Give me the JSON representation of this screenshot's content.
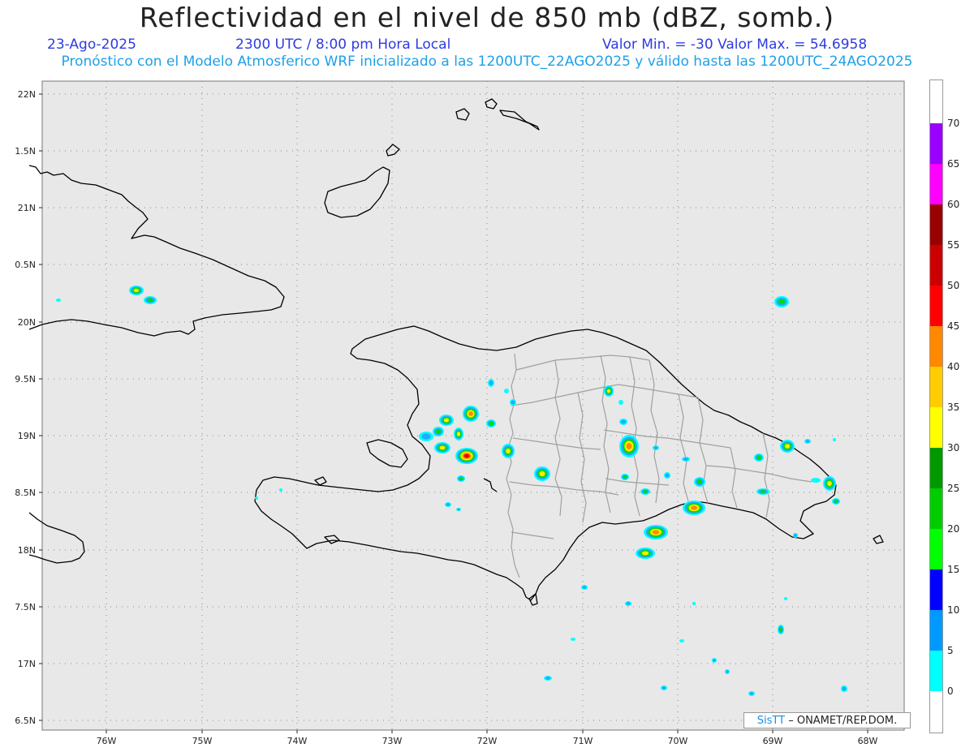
{
  "header": {
    "title": "Reflectividad en el nivel de 850 mb (dBZ, somb.)",
    "date": "23-Ago-2025",
    "time": "2300 UTC / 8:00 pm Hora Local",
    "stats": "Valor Min. = -30  Valor Max. = 54.6958",
    "forecast_info": "Pronóstico con el Modelo Atmosferico WRF inicializado a las 1200UTC_22AGO2025 y válido hasta las  1200UTC_24AGO2025"
  },
  "axes": {
    "lat_labels": [
      "22N",
      "1.5N",
      "21N",
      "0.5N",
      "20N",
      "9.5N",
      "19N",
      "8.5N",
      "18N",
      "7.5N",
      "17N",
      "6.5N"
    ],
    "lon_labels": [
      "76W",
      "75W",
      "74W",
      "73W",
      "72W",
      "71W",
      "70W",
      "69W",
      "68W"
    ]
  },
  "colorbar": {
    "labels": [
      "0",
      "5",
      "10",
      "15",
      "20",
      "25",
      "30",
      "35",
      "40",
      "45",
      "50",
      "55",
      "60",
      "65",
      "70"
    ],
    "colors": [
      "#00ffff",
      "#0099ff",
      "#0000ff",
      "#00ff00",
      "#00cc00",
      "#009900",
      "#ffff00",
      "#ffcc00",
      "#ff8800",
      "#ff0000",
      "#cc0000",
      "#990000",
      "#ff00ff",
      "#9900ff"
    ]
  },
  "credit": {
    "brand": "SisTT",
    "text": "– ONAMET/REP.DOM."
  },
  "colors": {
    "map_background": "#e8e8e8",
    "coastline": "#000000",
    "borders": "#a0a0a0",
    "grid": "#888888"
  }
}
